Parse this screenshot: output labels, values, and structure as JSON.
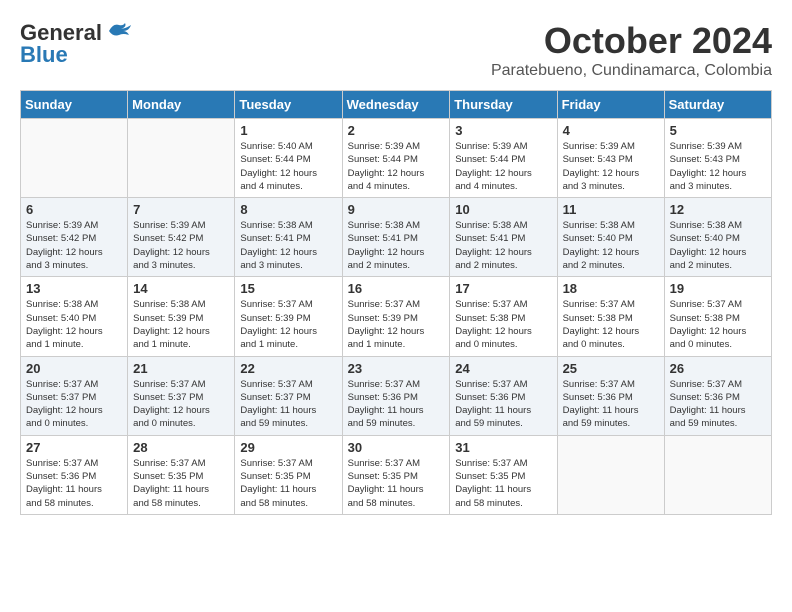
{
  "logo": {
    "general": "General",
    "blue": "Blue"
  },
  "header": {
    "month": "October 2024",
    "location": "Paratebueno, Cundinamarca, Colombia"
  },
  "weekdays": [
    "Sunday",
    "Monday",
    "Tuesday",
    "Wednesday",
    "Thursday",
    "Friday",
    "Saturday"
  ],
  "weeks": [
    [
      {
        "day": "",
        "info": ""
      },
      {
        "day": "",
        "info": ""
      },
      {
        "day": "1",
        "info": "Sunrise: 5:40 AM\nSunset: 5:44 PM\nDaylight: 12 hours\nand 4 minutes."
      },
      {
        "day": "2",
        "info": "Sunrise: 5:39 AM\nSunset: 5:44 PM\nDaylight: 12 hours\nand 4 minutes."
      },
      {
        "day": "3",
        "info": "Sunrise: 5:39 AM\nSunset: 5:44 PM\nDaylight: 12 hours\nand 4 minutes."
      },
      {
        "day": "4",
        "info": "Sunrise: 5:39 AM\nSunset: 5:43 PM\nDaylight: 12 hours\nand 3 minutes."
      },
      {
        "day": "5",
        "info": "Sunrise: 5:39 AM\nSunset: 5:43 PM\nDaylight: 12 hours\nand 3 minutes."
      }
    ],
    [
      {
        "day": "6",
        "info": "Sunrise: 5:39 AM\nSunset: 5:42 PM\nDaylight: 12 hours\nand 3 minutes."
      },
      {
        "day": "7",
        "info": "Sunrise: 5:39 AM\nSunset: 5:42 PM\nDaylight: 12 hours\nand 3 minutes."
      },
      {
        "day": "8",
        "info": "Sunrise: 5:38 AM\nSunset: 5:41 PM\nDaylight: 12 hours\nand 3 minutes."
      },
      {
        "day": "9",
        "info": "Sunrise: 5:38 AM\nSunset: 5:41 PM\nDaylight: 12 hours\nand 2 minutes."
      },
      {
        "day": "10",
        "info": "Sunrise: 5:38 AM\nSunset: 5:41 PM\nDaylight: 12 hours\nand 2 minutes."
      },
      {
        "day": "11",
        "info": "Sunrise: 5:38 AM\nSunset: 5:40 PM\nDaylight: 12 hours\nand 2 minutes."
      },
      {
        "day": "12",
        "info": "Sunrise: 5:38 AM\nSunset: 5:40 PM\nDaylight: 12 hours\nand 2 minutes."
      }
    ],
    [
      {
        "day": "13",
        "info": "Sunrise: 5:38 AM\nSunset: 5:40 PM\nDaylight: 12 hours\nand 1 minute."
      },
      {
        "day": "14",
        "info": "Sunrise: 5:38 AM\nSunset: 5:39 PM\nDaylight: 12 hours\nand 1 minute."
      },
      {
        "day": "15",
        "info": "Sunrise: 5:37 AM\nSunset: 5:39 PM\nDaylight: 12 hours\nand 1 minute."
      },
      {
        "day": "16",
        "info": "Sunrise: 5:37 AM\nSunset: 5:39 PM\nDaylight: 12 hours\nand 1 minute."
      },
      {
        "day": "17",
        "info": "Sunrise: 5:37 AM\nSunset: 5:38 PM\nDaylight: 12 hours\nand 0 minutes."
      },
      {
        "day": "18",
        "info": "Sunrise: 5:37 AM\nSunset: 5:38 PM\nDaylight: 12 hours\nand 0 minutes."
      },
      {
        "day": "19",
        "info": "Sunrise: 5:37 AM\nSunset: 5:38 PM\nDaylight: 12 hours\nand 0 minutes."
      }
    ],
    [
      {
        "day": "20",
        "info": "Sunrise: 5:37 AM\nSunset: 5:37 PM\nDaylight: 12 hours\nand 0 minutes."
      },
      {
        "day": "21",
        "info": "Sunrise: 5:37 AM\nSunset: 5:37 PM\nDaylight: 12 hours\nand 0 minutes."
      },
      {
        "day": "22",
        "info": "Sunrise: 5:37 AM\nSunset: 5:37 PM\nDaylight: 11 hours\nand 59 minutes."
      },
      {
        "day": "23",
        "info": "Sunrise: 5:37 AM\nSunset: 5:36 PM\nDaylight: 11 hours\nand 59 minutes."
      },
      {
        "day": "24",
        "info": "Sunrise: 5:37 AM\nSunset: 5:36 PM\nDaylight: 11 hours\nand 59 minutes."
      },
      {
        "day": "25",
        "info": "Sunrise: 5:37 AM\nSunset: 5:36 PM\nDaylight: 11 hours\nand 59 minutes."
      },
      {
        "day": "26",
        "info": "Sunrise: 5:37 AM\nSunset: 5:36 PM\nDaylight: 11 hours\nand 59 minutes."
      }
    ],
    [
      {
        "day": "27",
        "info": "Sunrise: 5:37 AM\nSunset: 5:36 PM\nDaylight: 11 hours\nand 58 minutes."
      },
      {
        "day": "28",
        "info": "Sunrise: 5:37 AM\nSunset: 5:35 PM\nDaylight: 11 hours\nand 58 minutes."
      },
      {
        "day": "29",
        "info": "Sunrise: 5:37 AM\nSunset: 5:35 PM\nDaylight: 11 hours\nand 58 minutes."
      },
      {
        "day": "30",
        "info": "Sunrise: 5:37 AM\nSunset: 5:35 PM\nDaylight: 11 hours\nand 58 minutes."
      },
      {
        "day": "31",
        "info": "Sunrise: 5:37 AM\nSunset: 5:35 PM\nDaylight: 11 hours\nand 58 minutes."
      },
      {
        "day": "",
        "info": ""
      },
      {
        "day": "",
        "info": ""
      }
    ]
  ]
}
